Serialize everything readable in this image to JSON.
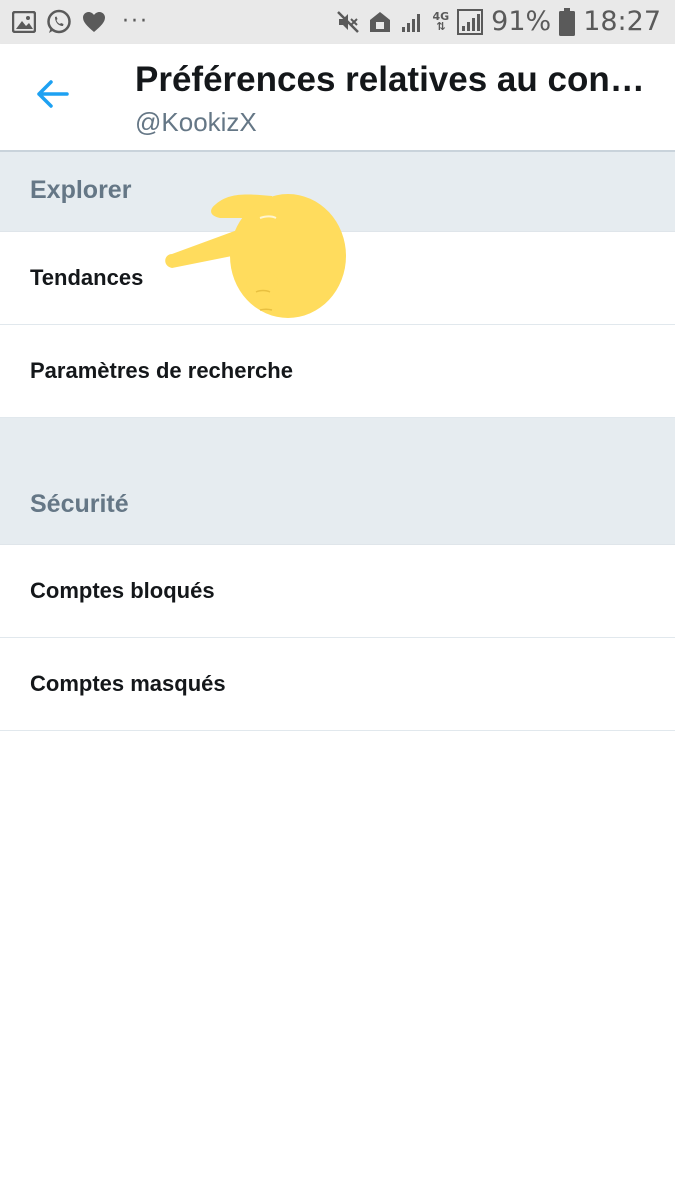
{
  "status_bar": {
    "battery_percent": "91%",
    "time": "18:27",
    "network_type": "4G",
    "icons": [
      "gallery-icon",
      "whatsapp-icon",
      "heart-icon",
      "more-dots-icon",
      "mute-icon",
      "home-icon",
      "signal-icon",
      "data-arrows-icon",
      "signal-full-icon",
      "battery-icon"
    ],
    "dots": "···"
  },
  "header": {
    "title": "Préférences relatives au contenu",
    "subtitle": "@KookizX",
    "back_icon": "arrow-left-icon",
    "accent_color": "#1da1f2"
  },
  "sections": [
    {
      "title": "Explorer",
      "items": [
        {
          "label": "Tendances"
        },
        {
          "label": "Paramètres de recherche"
        }
      ]
    },
    {
      "title": "Sécurité",
      "items": [
        {
          "label": "Comptes bloqués"
        },
        {
          "label": "Comptes masqués"
        }
      ]
    }
  ],
  "overlay": {
    "emoji": "pointing-left-hand-icon",
    "color": "#ffdc5d"
  }
}
